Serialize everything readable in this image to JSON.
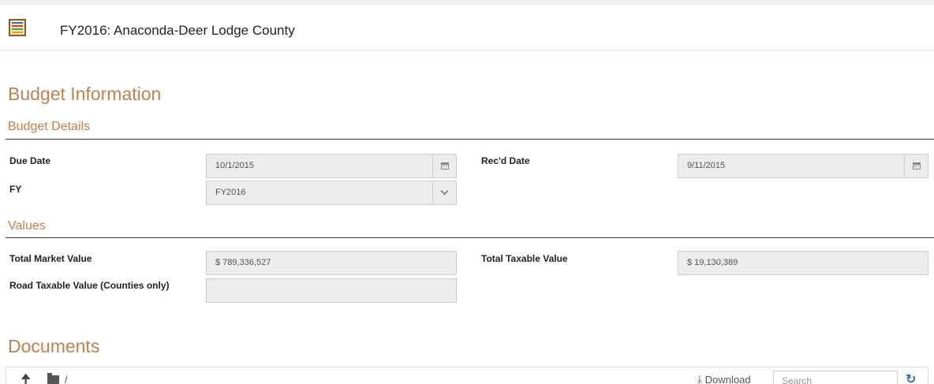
{
  "header": {
    "title": "FY2016: Anaconda-Deer Lodge County",
    "icon": "abacus-icon"
  },
  "budget_information": {
    "title": "Budget Information",
    "details": {
      "title": "Budget Details",
      "due_date_label": "Due Date",
      "due_date_value": "10/1/2015",
      "recd_date_label": "Rec'd Date",
      "recd_date_value": "9/11/2015",
      "fy_label": "FY",
      "fy_value": "FY2016"
    },
    "values": {
      "title": "Values",
      "total_market_label": "Total Market Value",
      "total_market_value": "$ 789,336,527",
      "total_taxable_label": "Total Taxable Value",
      "total_taxable_value": "$ 19,130,389",
      "road_taxable_label": "Road Taxable Value (Counties only)",
      "road_taxable_value": ""
    }
  },
  "documents": {
    "title": "Documents",
    "path": "/",
    "download_label": "Download",
    "search_placeholder": "Search"
  },
  "colors": {
    "section_heading": "#c0814d",
    "field_background": "#ececec",
    "refresh_icon": "#3b6fb6"
  }
}
